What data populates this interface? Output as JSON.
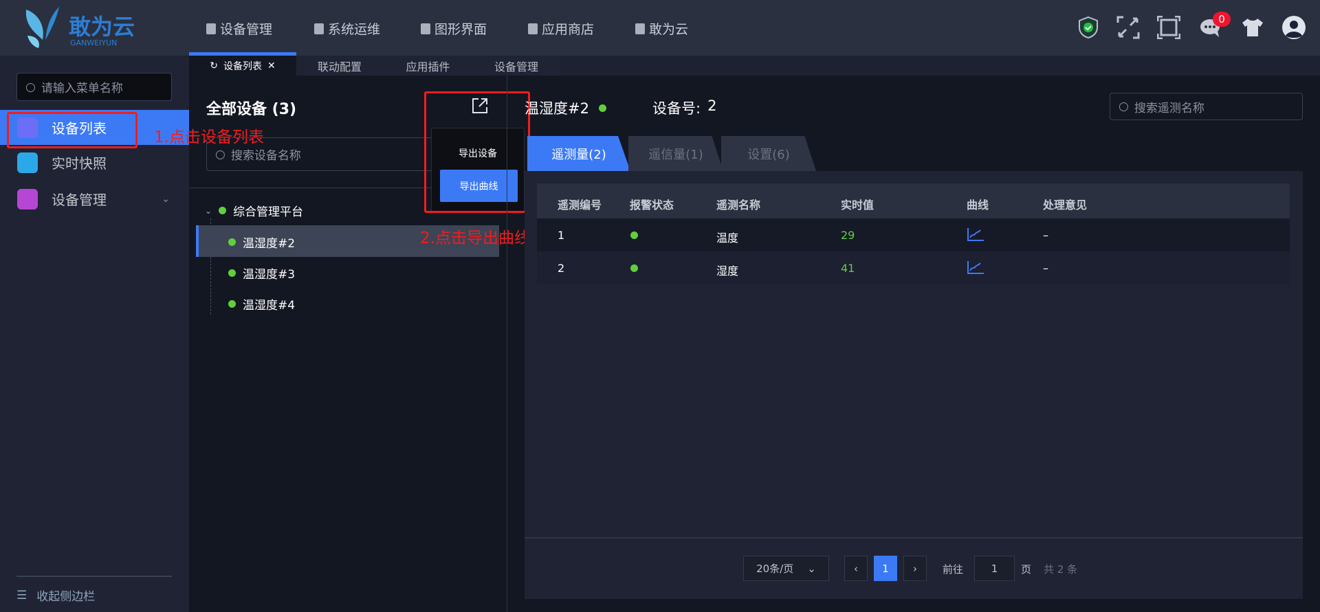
{
  "header": {
    "logo_text": "敢为云",
    "logo_sub": "GANWEIYUN",
    "nav": [
      "设备管理",
      "系统运维",
      "图形界面",
      "应用商店",
      "敢为云"
    ],
    "message_count": "0"
  },
  "tabs": [
    {
      "label": "设备列表",
      "active": true
    },
    {
      "label": "联动配置"
    },
    {
      "label": "应用插件"
    },
    {
      "label": "设备管理"
    }
  ],
  "sidebar": {
    "search_placeholder": "请输入菜单名称",
    "items": [
      {
        "label": "设备列表",
        "active": true
      },
      {
        "label": "实时快照"
      },
      {
        "label": "设备管理"
      }
    ],
    "collapse_label": "收起侧边栏"
  },
  "device_panel": {
    "title": "全部设备 (3)",
    "search_placeholder": "搜索设备名称",
    "root": "综合管理平台",
    "devices": [
      "温湿度#2",
      "温湿度#3",
      "温湿度#4"
    ]
  },
  "export_menu": {
    "items": [
      "导出设备",
      "导出曲线"
    ]
  },
  "annotations": [
    "1.点击设备列表",
    "2.点击导出曲线"
  ],
  "detail": {
    "device_name": "温湿度#2",
    "device_no_label": "设备号:",
    "device_no": "2",
    "search_placeholder": "搜索遥测名称",
    "tabs": [
      "遥测量(2)",
      "遥信量(1)",
      "设置(6)"
    ],
    "columns": [
      "遥测编号",
      "报警状态",
      "遥测名称",
      "实时值",
      "曲线",
      "处理意见"
    ],
    "rows": [
      {
        "id": "1",
        "name": "温度",
        "value": "29",
        "advice": "–"
      },
      {
        "id": "2",
        "name": "湿度",
        "value": "41",
        "advice": "–"
      }
    ],
    "pagination": {
      "page_size": "20条/页",
      "current": "1",
      "goto_label": "前往",
      "goto_value": "1",
      "page_unit": "页",
      "total": "共 2 条"
    }
  },
  "colors": {
    "accent": "#3c7af5",
    "ok": "#5fd03c",
    "annotation": "#f31d1d"
  }
}
